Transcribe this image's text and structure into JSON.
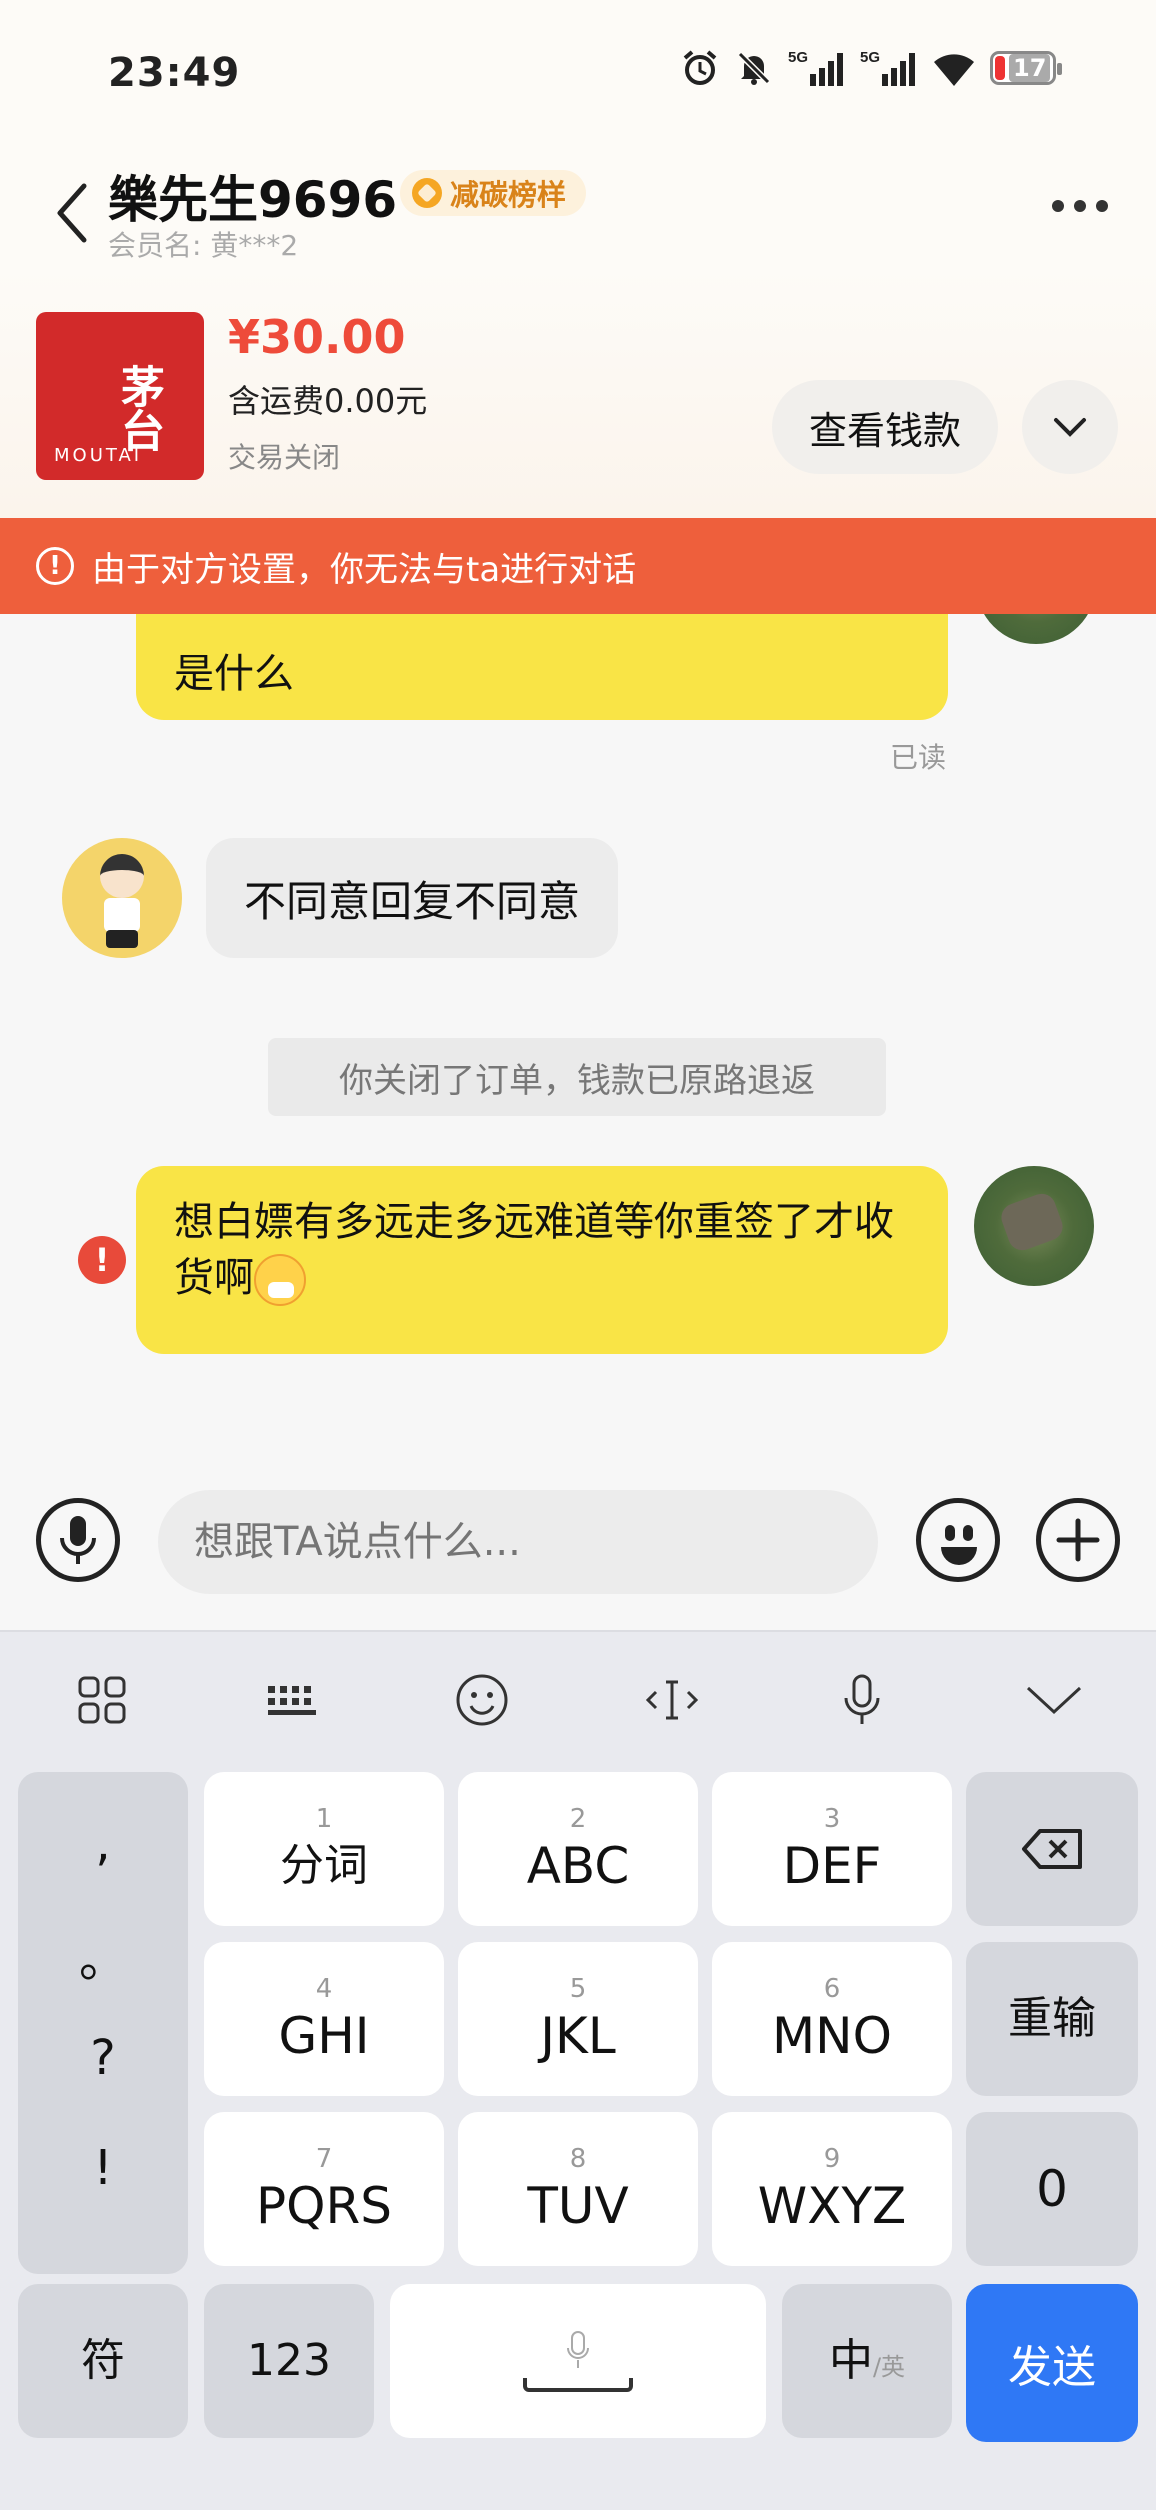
{
  "status_bar": {
    "time": "23:49",
    "network_1": "5G",
    "network_2": "5G",
    "battery": "17"
  },
  "header": {
    "shop_name": "樂先生9696",
    "badge": "减碳榜样",
    "member_label": "会员名: 黄***2"
  },
  "product": {
    "thumb_brand": "茅台",
    "thumb_en": "MOUTAI",
    "price": "¥30.00",
    "shipping": "含运费0.00元",
    "status": "交易关闭",
    "view_button": "查看钱款"
  },
  "notice": {
    "text": "由于对方设置，你无法与ta进行对话"
  },
  "messages": {
    "m1_text": "是什么",
    "m1_read": "已读",
    "m2_text": "不同意回复不同意",
    "system": "你关闭了订单，钱款已原路退返",
    "m3_text": "想白嫖有多远走多远难道等你重签了才收货啊",
    "error_mark": "!"
  },
  "input": {
    "placeholder": "想跟TA说点什么..."
  },
  "keyboard": {
    "punct": [
      ",",
      "。",
      "?",
      "!"
    ],
    "keys": [
      {
        "num": "1",
        "label": "分词"
      },
      {
        "num": "2",
        "label": "ABC"
      },
      {
        "num": "3",
        "label": "DEF"
      },
      {
        "num": "4",
        "label": "GHI"
      },
      {
        "num": "5",
        "label": "JKL"
      },
      {
        "num": "6",
        "label": "MNO"
      },
      {
        "num": "7",
        "label": "PQRS"
      },
      {
        "num": "8",
        "label": "TUV"
      },
      {
        "num": "9",
        "label": "WXYZ"
      }
    ],
    "retype": "重输",
    "zero": "0",
    "symbols": "符",
    "numbers": "123",
    "lang_main": "中",
    "lang_sub": "/英",
    "send": "发送"
  },
  "colors": {
    "accent_orange": "#ee5f3c",
    "bubble_yellow": "#f9e446",
    "price_red": "#ee4b3a",
    "send_blue": "#2f78f5"
  }
}
